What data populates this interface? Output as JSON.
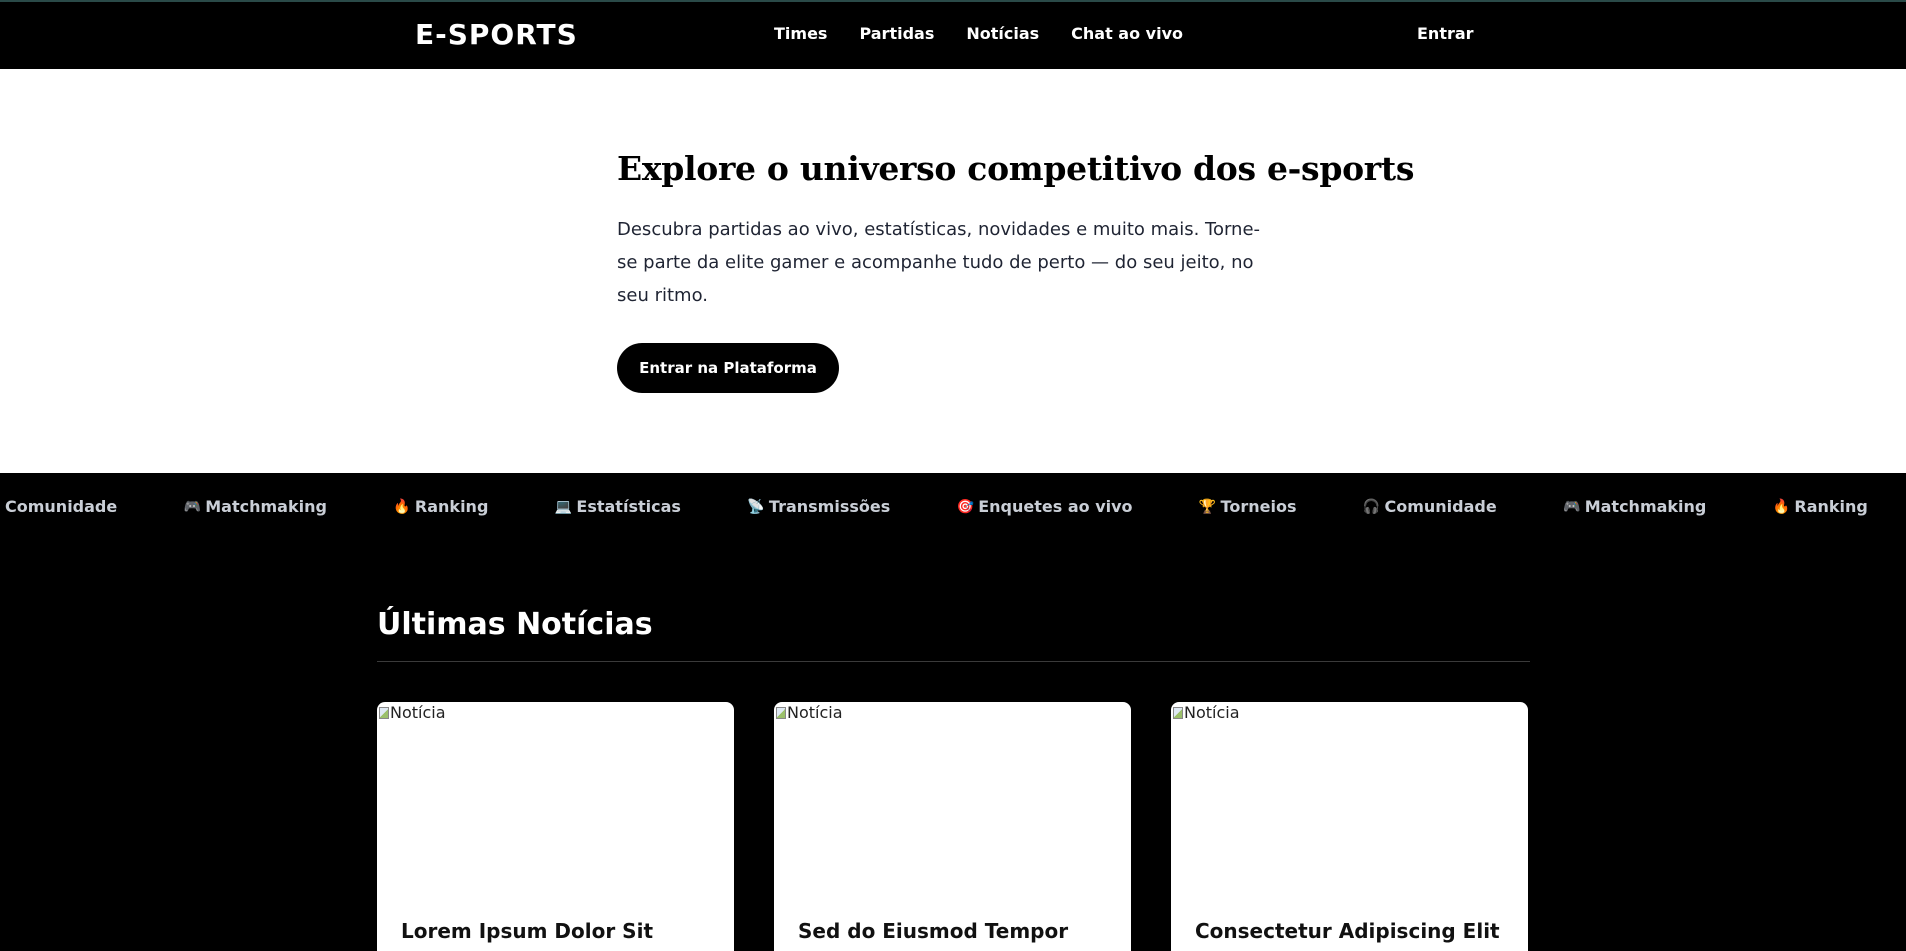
{
  "navbar": {
    "logo": "E-SPORTS",
    "links": [
      "Times",
      "Partidas",
      "Notícias",
      "Chat ao vivo"
    ],
    "login": "Entrar"
  },
  "hero": {
    "title": "Explore o universo competitivo dos e-sports",
    "description": "Descubra partidas ao vivo, estatísticas, novidades e muito mais. Torne-se parte da elite gamer e acompanhe tudo de perto — do seu jeito, no seu ritmo.",
    "button": "Entrar na Plataforma"
  },
  "ticker": {
    "items": [
      {
        "icon": "headphones-icon",
        "glyph": "🎧",
        "label": "Comunidade"
      },
      {
        "icon": "gamepad-icon",
        "glyph": "🎮",
        "label": "Matchmaking"
      },
      {
        "icon": "fire-icon",
        "glyph": "🔥",
        "label": "Ranking"
      },
      {
        "icon": "laptop-icon",
        "glyph": "💻",
        "label": "Estatísticas"
      },
      {
        "icon": "satellite-icon",
        "glyph": "📡",
        "label": "Transmissões"
      },
      {
        "icon": "target-icon",
        "glyph": "🎯",
        "label": "Enquetes ao vivo"
      },
      {
        "icon": "trophy-icon",
        "glyph": "🏆",
        "label": "Torneios"
      },
      {
        "icon": "headphones-icon",
        "glyph": "🎧",
        "label": "Comunidade"
      },
      {
        "icon": "gamepad-icon",
        "glyph": "🎮",
        "label": "Matchmaking"
      },
      {
        "icon": "fire-icon",
        "glyph": "🔥",
        "label": "Ranking"
      },
      {
        "icon": "laptop-icon",
        "glyph": "💻",
        "label": "Estatísticas"
      }
    ]
  },
  "news": {
    "title": "Últimas Notícias",
    "cards": [
      {
        "image_alt": "Notícia",
        "title": "Lorem Ipsum Dolor Sit"
      },
      {
        "image_alt": "Notícia",
        "title": "Sed do Eiusmod Tempor"
      },
      {
        "image_alt": "Notícia",
        "title": "Consectetur Adipiscing Elit"
      }
    ]
  }
}
